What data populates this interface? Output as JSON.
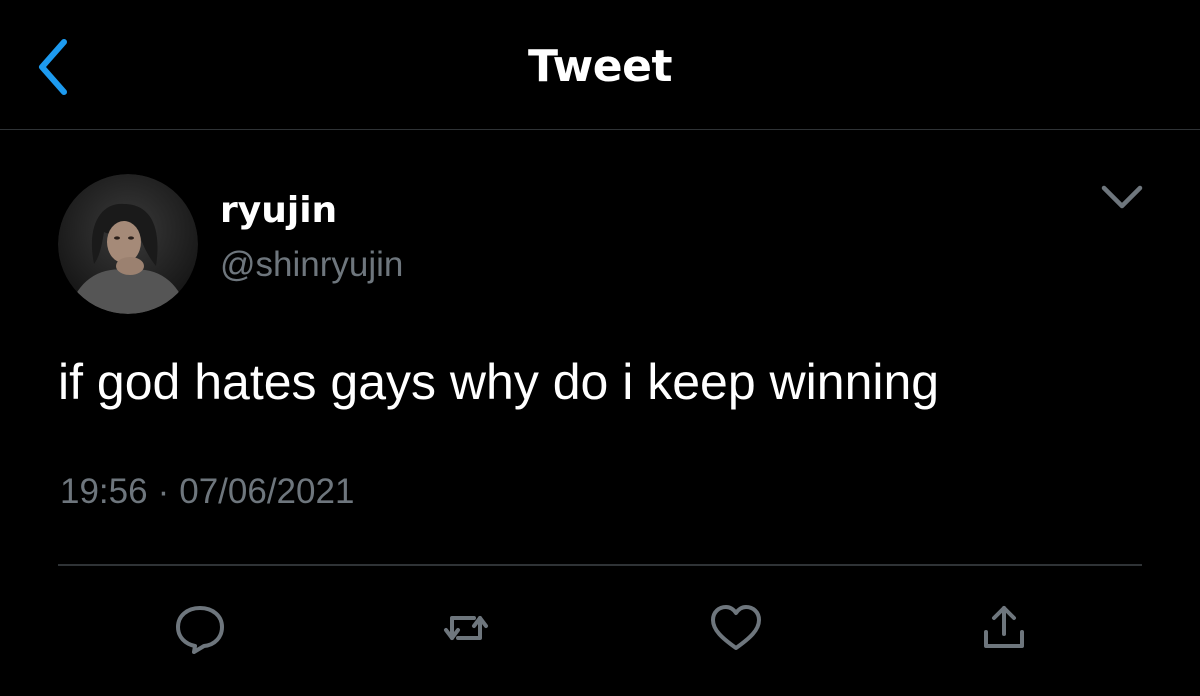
{
  "header": {
    "title": "Tweet",
    "back_icon": "chevron-left-icon"
  },
  "tweet": {
    "author": {
      "display_name": "ryujin",
      "handle": "@shinryujin"
    },
    "text": "if god hates gays why do i keep winning",
    "time": "19:56",
    "separator": "·",
    "date": "07/06/2021"
  },
  "actions": [
    "reply-icon",
    "retweet-icon",
    "like-icon",
    "share-icon"
  ],
  "colors": {
    "background": "#000000",
    "accent": "#1d9bf0",
    "text_primary": "#ffffff",
    "text_secondary": "#6e767d",
    "divider": "#2f3336"
  }
}
